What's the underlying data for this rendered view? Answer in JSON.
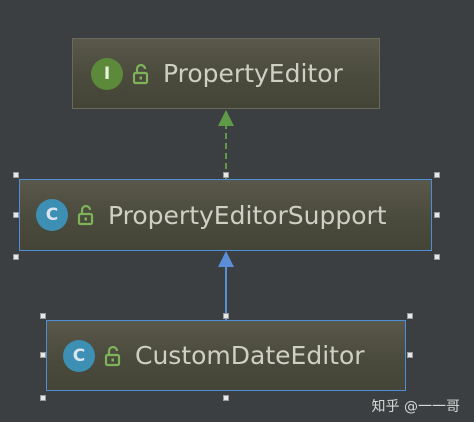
{
  "nodes": [
    {
      "id": "property-editor",
      "kind": "interface",
      "badge": "I",
      "label": "PropertyEditor"
    },
    {
      "id": "property-editor-support",
      "kind": "class",
      "badge": "C",
      "label": "PropertyEditorSupport"
    },
    {
      "id": "custom-date-editor",
      "kind": "class",
      "badge": "C",
      "label": "CustomDateEditor"
    }
  ],
  "edges": [
    {
      "from": "property-editor-support",
      "to": "property-editor",
      "style": "dashed",
      "color": "#5f9a49"
    },
    {
      "from": "custom-date-editor",
      "to": "property-editor-support",
      "style": "solid",
      "color": "#5a8fd8"
    }
  ],
  "colors": {
    "interface_badge": "#5c8a3a",
    "class_badge": "#3d8fb3",
    "lock": "#7fb35a",
    "selection": "#4d8fd6"
  },
  "watermark": "知乎 @一一哥"
}
